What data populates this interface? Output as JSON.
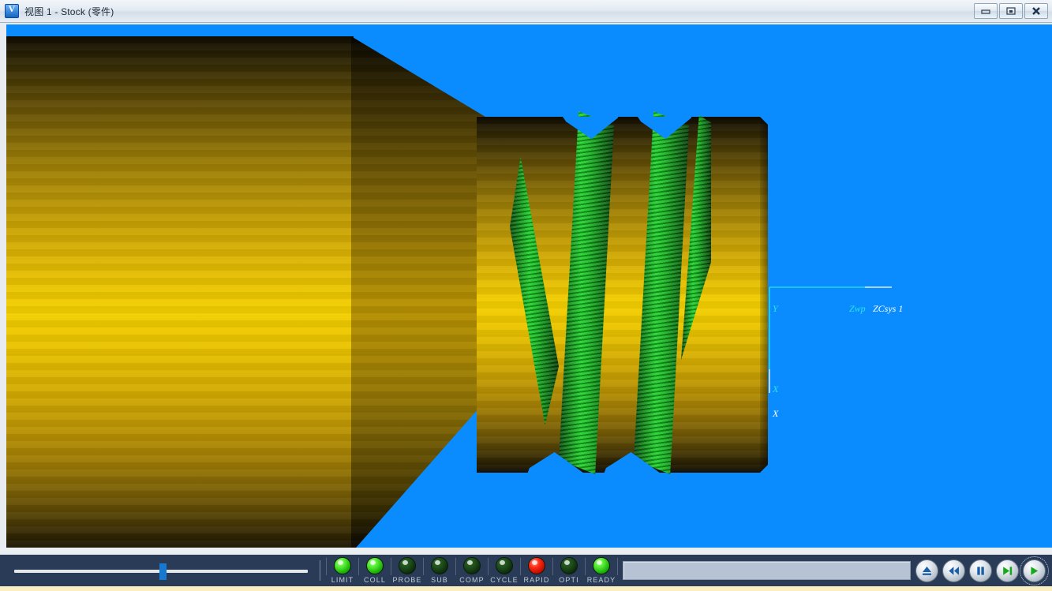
{
  "window": {
    "title": "视图 1 - Stock (零件)",
    "icon": "view-app-icon",
    "minimize_label": "Minimize",
    "maximize_label": "Maximize",
    "close_label": "Close"
  },
  "viewport": {
    "background_color": "#0a8cff",
    "part_color": "#f3cf00",
    "cut_color": "#1ed22a",
    "csys": {
      "axis_y_label": "Y",
      "axis_x_label_cyan": "X",
      "axis_x_label_white": "X",
      "wcs_label": "Zwp",
      "csys_label": "ZCsys 1",
      "cyan_color": "#26e6e6",
      "white_color": "#ffffff"
    }
  },
  "controlbar": {
    "speed_slider": {
      "name": "animation-speed-slider",
      "value_percent": 48
    },
    "leds": [
      {
        "label": "LIMIT",
        "state": "on"
      },
      {
        "label": "COLL",
        "state": "on"
      },
      {
        "label": "PROBE",
        "state": "off"
      },
      {
        "label": "SUB",
        "state": "off"
      },
      {
        "label": "COMP",
        "state": "off"
      },
      {
        "label": "CYCLE",
        "state": "off"
      },
      {
        "label": "RAPID",
        "state": "red"
      },
      {
        "label": "OPTI",
        "state": "off"
      },
      {
        "label": "READY",
        "state": "on"
      }
    ],
    "progress": {
      "label": "Simulation progress",
      "value_percent": 0
    },
    "transport": [
      {
        "name": "eject-button",
        "icon": "eject-icon",
        "color": "#1c5fa8"
      },
      {
        "name": "rewind-button",
        "icon": "rewind-icon",
        "color": "#1c5fa8"
      },
      {
        "name": "pause-button",
        "icon": "pause-icon",
        "color": "#1c5fa8"
      },
      {
        "name": "step-forward-button",
        "icon": "step-forward-icon",
        "color": "#18a81c"
      },
      {
        "name": "play-button",
        "icon": "play-icon",
        "color": "#18a81c"
      }
    ]
  }
}
